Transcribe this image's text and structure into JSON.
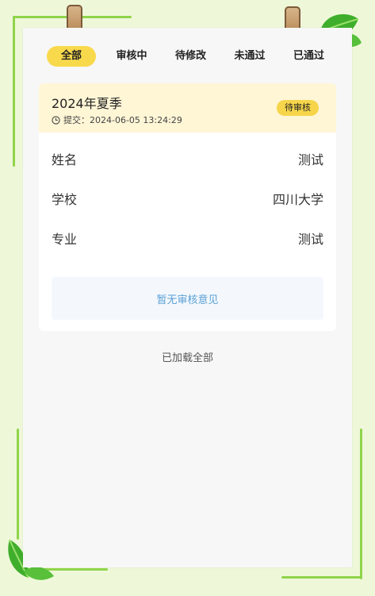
{
  "tabs": [
    {
      "label": "全部",
      "active": true
    },
    {
      "label": "审核中",
      "active": false
    },
    {
      "label": "待修改",
      "active": false
    },
    {
      "label": "未通过",
      "active": false
    },
    {
      "label": "已通过",
      "active": false
    }
  ],
  "record": {
    "title": "2024年夏季",
    "time_label": "提交：2024-06-05 13:24:29",
    "status": "待审核",
    "fields": [
      {
        "label": "姓名",
        "value": "测试"
      },
      {
        "label": "学校",
        "value": "四川大学"
      },
      {
        "label": "专业",
        "value": "测试"
      }
    ],
    "review_placeholder": "暂无审核意见"
  },
  "footer": {
    "loaded_text": "已加载全部"
  },
  "colors": {
    "background": "#eef8d9",
    "accent_yellow": "#f8d94b",
    "card_header": "#fff6d6",
    "review_text": "#5aa0d6",
    "frame_green": "#8fd44a"
  },
  "icons": [
    "clock-icon",
    "leaf-icon",
    "clip-icon"
  ]
}
